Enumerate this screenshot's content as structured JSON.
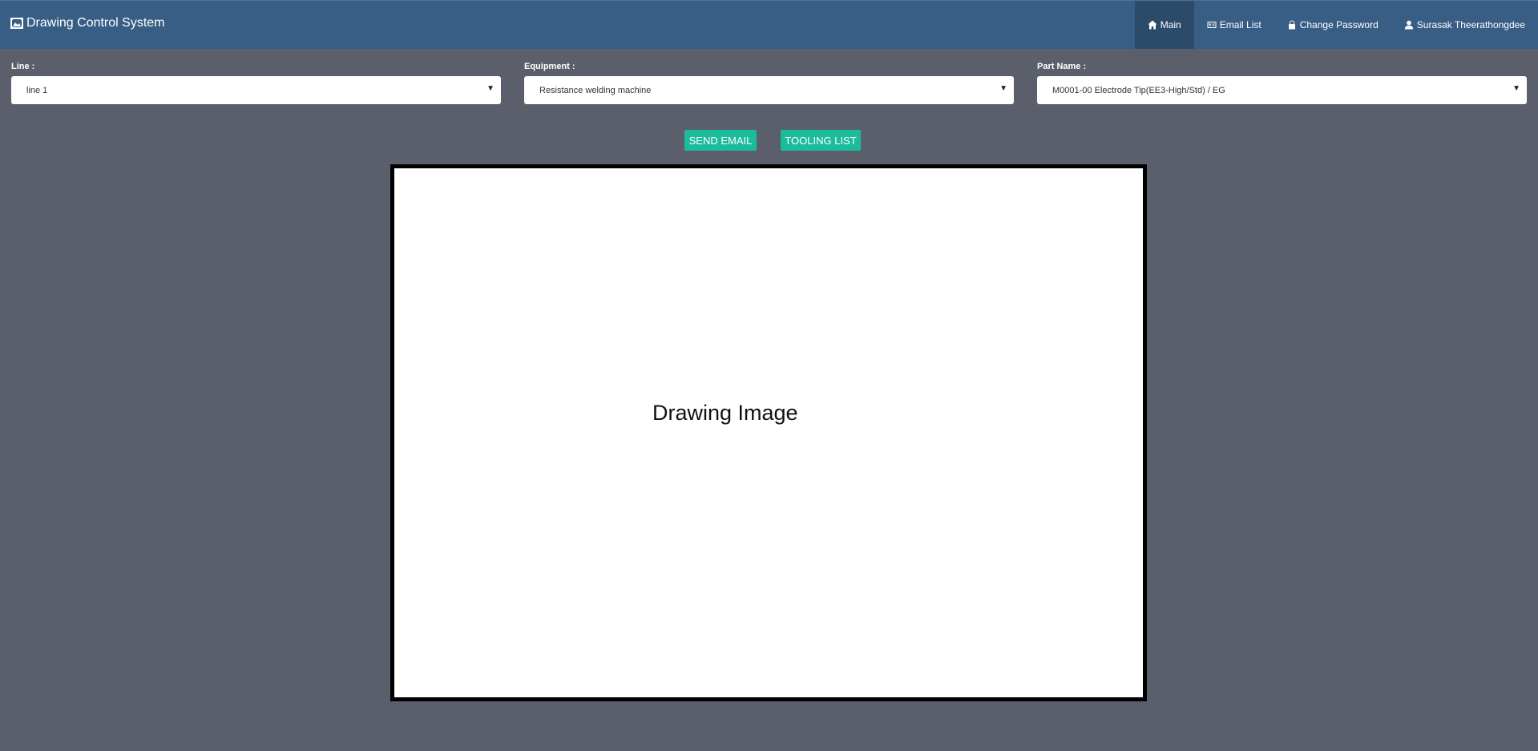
{
  "app": {
    "title": "Drawing Control System",
    "brand_icon": "image-frame-icon"
  },
  "nav": {
    "items": [
      {
        "label": "Main",
        "icon": "home-icon",
        "active": true
      },
      {
        "label": "Email List",
        "icon": "id-card-icon",
        "active": false
      },
      {
        "label": "Change Password",
        "icon": "lock-icon",
        "active": false
      },
      {
        "label": "Surasak Theerathongdee",
        "icon": "user-icon",
        "active": false
      }
    ]
  },
  "filters": {
    "line": {
      "label": "Line :",
      "value": "line 1"
    },
    "equipment": {
      "label": "Equipment :",
      "value": "Resistance welding machine"
    },
    "part_name": {
      "label": "Part Name :",
      "value": "M0001-00 Electrode Tip(EE3-High/Std) / EG"
    }
  },
  "actions": {
    "send_email": "SEND EMAIL",
    "tooling_list": "TOOLING LIST"
  },
  "drawing": {
    "placeholder": "Drawing Image"
  },
  "colors": {
    "navbar": "#385e85",
    "navbar_active": "#2c4b6b",
    "background": "#5b5f6b",
    "button": "#1abc9c"
  }
}
